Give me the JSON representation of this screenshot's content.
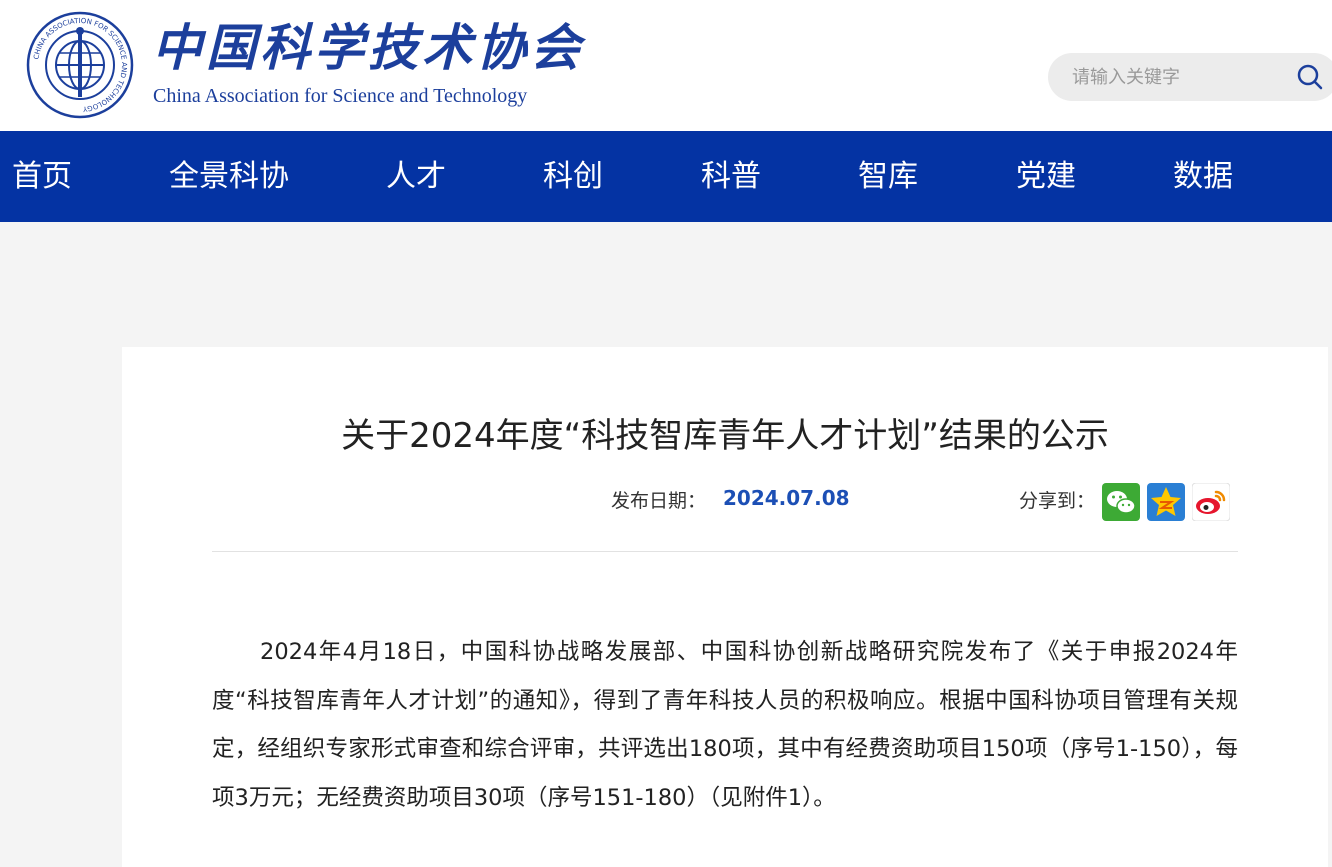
{
  "header": {
    "logo_cn": "中国科学技术协会",
    "logo_en": "China Association for Science and Technology",
    "emblem_top_text": "中国科学技术协会",
    "emblem_ring_text": "CHINA ASSOCIATION FOR SCIENCE AND TECHNOLOGY",
    "search_placeholder": "请输入关键字",
    "search_icon": "search-icon"
  },
  "nav": {
    "items": [
      "首页",
      "全景科协",
      "人才",
      "科创",
      "科普",
      "智库",
      "党建",
      "数据"
    ]
  },
  "article": {
    "title": "关于2024年度“科技智库青年人才计划”结果的公示",
    "date_label": "发布日期：",
    "date": "2024.07.08",
    "share_label": "分享到：",
    "share_icons": [
      "wechat-icon",
      "qzone-icon",
      "weibo-icon"
    ],
    "paragraph": "2024年4月18日，中国科协战略发展部、中国科协创新战略研究院发布了《关于申报2024年度“科技智库青年人才计划”的通知》，得到了青年科技人员的积极响应。根据中国科协项目管理有关规定，经组织专家形式审查和综合评审，共评选出180项，其中有经费资助项目150项（序号1-150），每项3万元；无经费资助项目30项（序号151-180）（见附件1）。"
  },
  "colors": {
    "brand_blue": "#0433a3",
    "logo_blue": "#1c3f9c",
    "date_blue": "#1c4fb5",
    "page_bg": "#f4f4f4"
  }
}
